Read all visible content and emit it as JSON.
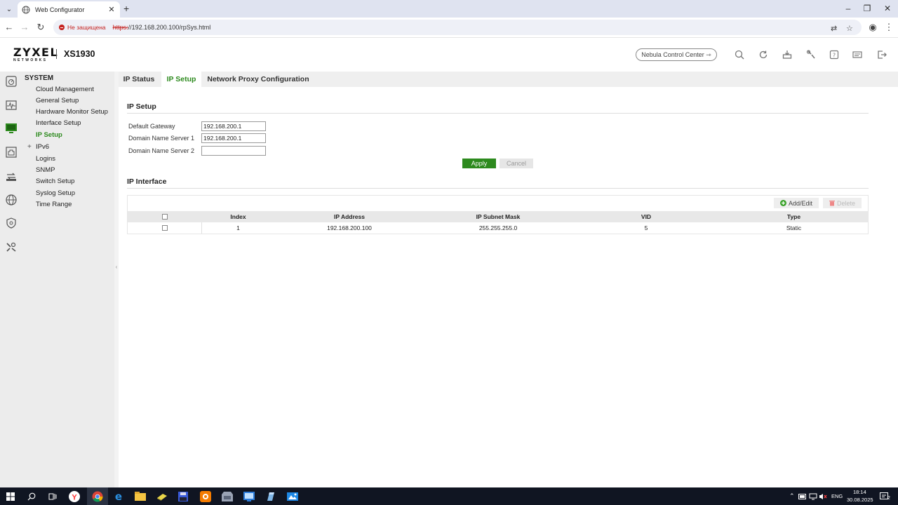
{
  "browser": {
    "tab_title": "Web Configurator",
    "not_secure": "Не защищена",
    "url_scheme": "https:",
    "url_rest": "//192.168.200.100/rpSys.html"
  },
  "header": {
    "logo": "ZYXEL",
    "logo_sub": "NETWORKS",
    "model": "XS1930",
    "nebula_btn": "Nebula Control Center ⇾"
  },
  "subnav": {
    "title": "SYSTEM",
    "items": [
      {
        "label": "Cloud Management"
      },
      {
        "label": "General Setup"
      },
      {
        "label": "Hardware Monitor Setup"
      },
      {
        "label": "Interface Setup"
      },
      {
        "label": "IP Setup"
      },
      {
        "label": "IPv6"
      },
      {
        "label": "Logins"
      },
      {
        "label": "SNMP"
      },
      {
        "label": "Switch Setup"
      },
      {
        "label": "Syslog Setup"
      },
      {
        "label": "Time Range"
      }
    ]
  },
  "tabs": [
    {
      "label": "IP Status"
    },
    {
      "label": "IP Setup"
    },
    {
      "label": "Network Proxy Configuration"
    }
  ],
  "ip_setup": {
    "title": "IP Setup",
    "fields": [
      {
        "label": "Default Gateway",
        "value": "192.168.200.1"
      },
      {
        "label": "Domain Name Server 1",
        "value": "192.168.200.1"
      },
      {
        "label": "Domain Name Server 2",
        "value": ""
      }
    ],
    "apply": "Apply",
    "cancel": "Cancel"
  },
  "ip_interface": {
    "title": "IP Interface",
    "add_edit": "Add/Edit",
    "delete": "Delete",
    "columns": [
      "Index",
      "IP Address",
      "IP Subnet Mask",
      "VID",
      "Type"
    ],
    "rows": [
      {
        "index": "1",
        "ip": "192.168.200.100",
        "mask": "255.255.255.0",
        "vid": "5",
        "type": "Static"
      }
    ]
  },
  "taskbar": {
    "lang": "ENG",
    "time": "18:14",
    "date": "30.08.2025",
    "notif": "2"
  },
  "colors": {
    "accent_green": "#2d8a1e",
    "warning_red": "#c5221f"
  }
}
